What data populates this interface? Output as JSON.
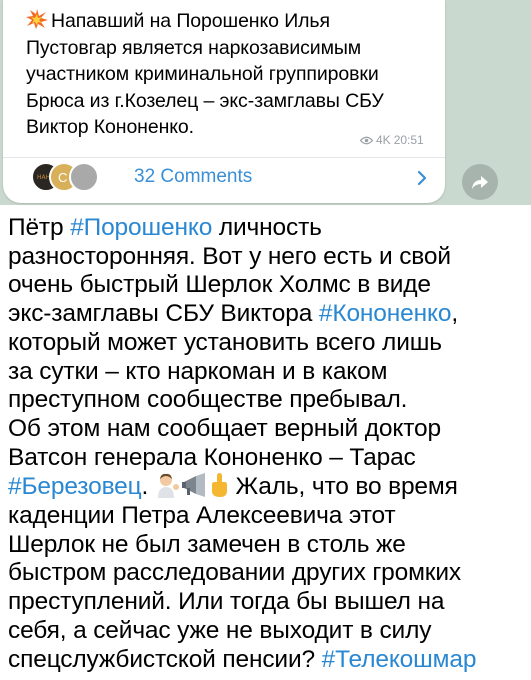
{
  "channel_post": {
    "line1": "Напавший на Порошенко Илья",
    "line2": "Пустовгар является наркозависимым",
    "line3": "участником криминальной группировки",
    "line4": "Брюса из г.Козелец – экс-замглавы СБУ",
    "line5": "Виктор Кононенко.",
    "views": "4K",
    "time": "20:51",
    "comments_label": "32 Comments",
    "avatar_text_1": "НАНЕ",
    "avatar_text_2": "С"
  },
  "message": {
    "l1_a": "Пётр ",
    "l1_tag": "#Порошенко",
    "l1_b": " личность",
    "l2": "разносторонняя. Вот у него есть и свой",
    "l3": "очень быстрый Шерлок Холмс в виде",
    "l4_a": "экс-замглавы СБУ Виктора ",
    "l4_tag": "#Кононенко",
    "l4_b": ",",
    "l5": "который может установить всего лишь",
    "l6": "за сутки – кто наркоман и в каком",
    "l7": "преступном сообществе пребывал.",
    "l8": "Об этом нам сообщает верный доктор",
    "l9": "Ватсон генерала Кононенко – Тарас",
    "l10_tag": "#Березовец",
    "l10_a": ".",
    "l10_b": " Жаль, что во время",
    "l11": "каденции Петра Алексеевича этот",
    "l12": "Шерлок не был замечен в столь же",
    "l13": "быстром расследовании других громких",
    "l14": "преступлений. Или тогда бы вышел на",
    "l15": "себя, а сейчас уже не выходит в силу",
    "l16_a": "спецслужбистской пенсии? ",
    "l16_tag": "#Телекошмар"
  },
  "icons": [
    "collision-icon",
    "eye-icon",
    "chevron-right-icon",
    "share-icon",
    "man-tipping-hand-icon",
    "megaphone-icon",
    "pointing-up-icon"
  ],
  "colors": {
    "link": "#2a88d2",
    "comments": "#3a8fd6",
    "chat_bg": "#c9d9cf",
    "meta": "#9aa1a7"
  }
}
